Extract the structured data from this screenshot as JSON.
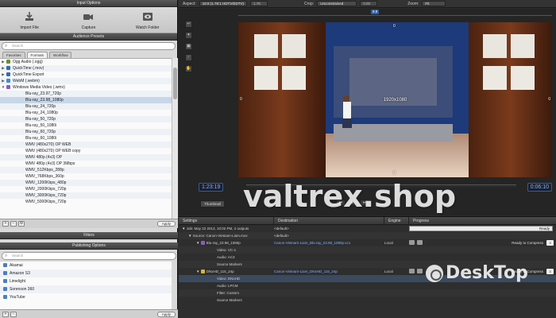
{
  "left_panel": {
    "input_options_title": "Input Options",
    "input_buttons": [
      {
        "label": "Import File",
        "icon": "import-icon"
      },
      {
        "label": "Capture",
        "icon": "video-camera-icon"
      },
      {
        "label": "Watch Folder",
        "icon": "eye-icon"
      }
    ],
    "audience_presets_title": "Audience Presets",
    "search_placeholder": "Search",
    "tabs": [
      "Favorites",
      "Formats",
      "Workflow"
    ],
    "active_tab": "Formats",
    "format_groups": [
      {
        "label": "Ogg Audio (.ogg)",
        "color": "#6b8e2a"
      },
      {
        "label": "QuickTime (.mov)",
        "color": "#2f6db3"
      },
      {
        "label": "QuickTime Export",
        "color": "#2f6db3"
      },
      {
        "label": "WebM (.webm)",
        "color": "#3a8fd0"
      },
      {
        "label": "Windows Media Video (.wmv)",
        "color": "#8a5bbf"
      }
    ],
    "wmv_presets": [
      "Blu-ray_23.97_720p",
      "Blu-ray_23.98_1080p",
      "Blu-ray_24_720p",
      "Blu-ray_24_1080p",
      "Blu-ray_50_720p",
      "Blu-ray_50_1080i",
      "Blu-ray_60_720p",
      "Blu-ray_60_1080i",
      "WMV (480x270) OP WEB",
      "WMV (480x270) OP WEB copy",
      "WMV 480p (4x3) OP",
      "WMV 480p (4x3) OP 3Mbps",
      "WMV_512Kbps_288p",
      "WMV_768Kbps_360p",
      "WMV_1200Kbps_480p",
      "WMV_2000Kbps_720p",
      "WMV_3000Kbps_720p",
      "WMV_5000Kbps_720p"
    ],
    "selected_preset": "Blu-ray_23.98_1080p",
    "apply_label": "Apply",
    "filters_title": "Filters",
    "publishing_title": "Publishing Options",
    "publishing_items": [
      "Akamai",
      "Amazon S3",
      "Limelight",
      "Sorenson 360",
      "YouTube"
    ]
  },
  "toolbar": {
    "aspect_label": "Aspect:",
    "aspect_value": "16:9 (1.78:1 HDTV/EDTV)",
    "aspect_ratio": "1.78",
    "crop_label": "Crop:",
    "crop_value": "Unconstrained",
    "crop_num": "0.00",
    "zoom_label": "Zoom:",
    "zoom_value": "Fit"
  },
  "viewer": {
    "timeline_marker": "8.8",
    "top_value": "0",
    "resolution_label": "1920x1080",
    "left_value": "0",
    "right_value": "0",
    "bottom_value": "0",
    "timecode_in": "1:23:19",
    "timecode_out": "0:06:10",
    "view_mode": "Thumbnail",
    "tools": [
      "↩",
      "✦",
      "▣",
      "∕",
      "✋"
    ]
  },
  "jobs": {
    "headers": [
      "Settings",
      "Destination",
      "Engine",
      "Progress"
    ],
    "job_label": "Job: May 22 2013, 10:02 PM, 2 outputs",
    "job_dest": "<default>",
    "source_label": "Source: Canon-Vietnam-Liam.mov",
    "source_dest": "<default>",
    "ready_badge": "Ready",
    "targets": [
      {
        "name": "Blu-ray_23.98_1080p",
        "destination": "Canon-Vietnam-Liam_Blu-ray_23.98_1080p.vc1",
        "engine": "Local",
        "status": "Ready to Compress",
        "color": "#8a5bbf",
        "children": [
          "Video: VC-1",
          "Audio: AC3",
          "Source Markers"
        ]
      },
      {
        "name": "DNxHD_115_24p",
        "destination": "Canon-Vietnam-Liam_DNxHD_115_24p",
        "engine": "Local",
        "status": "Ready to Compress",
        "color": "#d9b43a",
        "children": [
          "Video: DNxHD",
          "Audio: LPCM",
          "Filter: Custom",
          "Source Markers"
        ]
      }
    ]
  },
  "overlays": {
    "watermark": "valtrex.shop",
    "brand": "DeskTop"
  }
}
